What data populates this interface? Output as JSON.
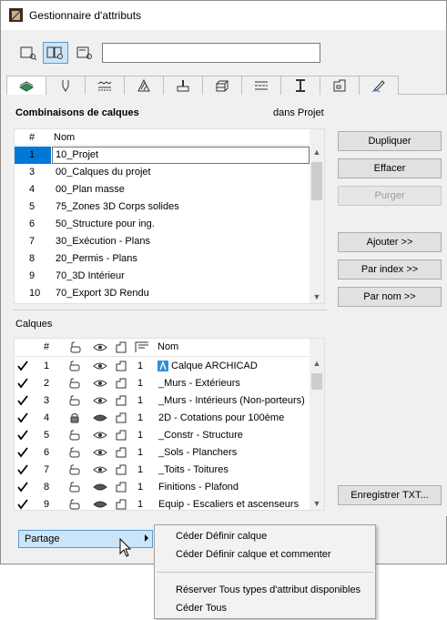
{
  "window": {
    "title": "Gestionnaire d'attributs"
  },
  "search": {
    "value": ""
  },
  "combos": {
    "title": "Combinaisons de calques",
    "scope": "dans Projet",
    "header": {
      "num": "#",
      "name": "Nom"
    },
    "rows": [
      {
        "num": "1",
        "name": "10_Projet"
      },
      {
        "num": "3",
        "name": "00_Calques du projet"
      },
      {
        "num": "4",
        "name": "00_Plan masse"
      },
      {
        "num": "5",
        "name": "75_Zones 3D Corps solides"
      },
      {
        "num": "6",
        "name": "50_Structure pour ing."
      },
      {
        "num": "7",
        "name": "30_Exécution - Plans"
      },
      {
        "num": "8",
        "name": "20_Permis - Plans"
      },
      {
        "num": "9",
        "name": "70_3D Intérieur"
      },
      {
        "num": "10",
        "name": "70_Export 3D Rendu"
      }
    ]
  },
  "buttons": {
    "duplicate": "Dupliquer",
    "delete": "Effacer",
    "purge": "Purger",
    "add": "Ajouter >>",
    "by_index": "Par index >>",
    "by_name": "Par nom >>",
    "save_txt": "Enregistrer TXT..."
  },
  "layers": {
    "title": "Calques",
    "header": {
      "num": "#",
      "name": "Nom"
    },
    "rows": [
      {
        "num": "1",
        "pen": "1",
        "name": "Calque ARCHICAD",
        "locked": false,
        "hidden": false
      },
      {
        "num": "2",
        "pen": "1",
        "name": "_Murs - Extérieurs",
        "locked": false,
        "hidden": false
      },
      {
        "num": "3",
        "pen": "1",
        "name": "_Murs - Intérieurs (Non-porteurs)",
        "locked": false,
        "hidden": false
      },
      {
        "num": "4",
        "pen": "1",
        "name": "2D - Cotations pour 100ème",
        "locked": true,
        "hidden": true
      },
      {
        "num": "5",
        "pen": "1",
        "name": "_Constr - Structure",
        "locked": false,
        "hidden": false
      },
      {
        "num": "6",
        "pen": "1",
        "name": "_Sols - Planchers",
        "locked": false,
        "hidden": false
      },
      {
        "num": "7",
        "pen": "1",
        "name": "_Toits - Toitures",
        "locked": false,
        "hidden": false
      },
      {
        "num": "8",
        "pen": "1",
        "name": "Finitions - Plafond",
        "locked": false,
        "hidden": true
      },
      {
        "num": "9",
        "pen": "1",
        "name": "Equip - Escaliers et ascenseurs",
        "locked": false,
        "hidden": true
      }
    ]
  },
  "share": {
    "label": "Partage"
  },
  "menu": {
    "items": [
      "Céder Définir calque",
      "Céder Définir calque et commenter",
      "Réserver Tous types d'attribut disponibles",
      "Céder Tous"
    ]
  }
}
